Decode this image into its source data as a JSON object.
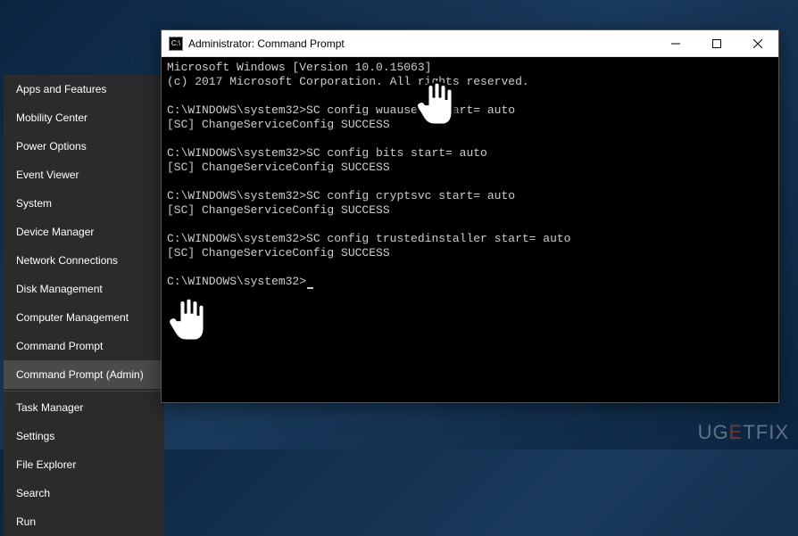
{
  "winx": {
    "items": [
      "Apps and Features",
      "Mobility Center",
      "Power Options",
      "Event Viewer",
      "System",
      "Device Manager",
      "Network Connections",
      "Disk Management",
      "Computer Management",
      "Command Prompt",
      "Command Prompt (Admin)",
      "Task Manager",
      "Settings",
      "File Explorer",
      "Search",
      "Run"
    ],
    "highlighted_index": 10,
    "separator_after": [
      10
    ]
  },
  "cmd": {
    "title": "Administrator: Command Prompt",
    "lines": [
      "Microsoft Windows [Version 10.0.15063]",
      "(c) 2017 Microsoft Corporation. All rights reserved.",
      "",
      "C:\\WINDOWS\\system32>SC config wuauserv start= auto",
      "[SC] ChangeServiceConfig SUCCESS",
      "",
      "C:\\WINDOWS\\system32>SC config bits start= auto",
      "[SC] ChangeServiceConfig SUCCESS",
      "",
      "C:\\WINDOWS\\system32>SC config cryptsvc start= auto",
      "[SC] ChangeServiceConfig SUCCESS",
      "",
      "C:\\WINDOWS\\system32>SC config trustedinstaller start= auto",
      "[SC] ChangeServiceConfig SUCCESS",
      "",
      "C:\\WINDOWS\\system32>"
    ]
  },
  "watermark": {
    "prefix": "UG",
    "mid": "E",
    "suffix": "TFIX"
  }
}
